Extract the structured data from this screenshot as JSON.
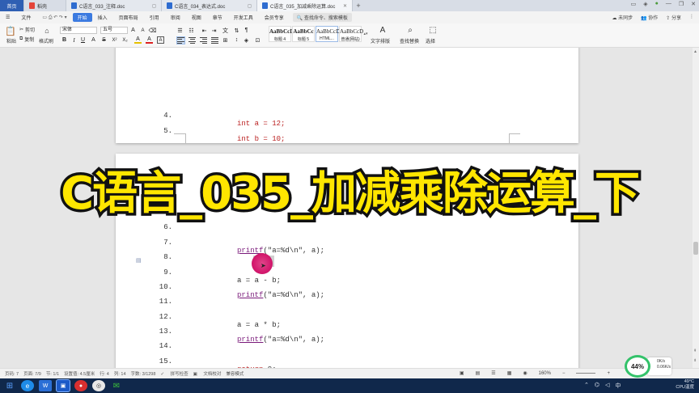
{
  "tabs": [
    {
      "label": "首页",
      "kind": "home"
    },
    {
      "label": "稻壳",
      "kind": "docer"
    },
    {
      "label": "C语言_033_注释.doc",
      "kind": "doc"
    },
    {
      "label": "C语言_034_表达式.doc",
      "kind": "doc"
    },
    {
      "label": "C语言_035_加减乘除运算.doc",
      "kind": "doc",
      "active": true
    }
  ],
  "menu": {
    "file": "文件",
    "items": [
      "开始",
      "插入",
      "页面布局",
      "引用",
      "审阅",
      "视图",
      "章节",
      "开发工具",
      "会员专享"
    ],
    "active": "开始",
    "search": "查找命令、搜索模板",
    "right": [
      "未同步",
      "协作",
      "分享"
    ]
  },
  "ribbon": {
    "paste": "粘贴",
    "cut": "剪切",
    "copy": "复制",
    "format_painter": "格式刷",
    "font_name": "宋体",
    "font_size": "五号",
    "styles": [
      {
        "preview": "AaBbCcDc",
        "name": "标题 4"
      },
      {
        "preview": "AaBbCc",
        "name": "标题 5"
      },
      {
        "preview": "AaBbCcDc",
        "name": "HTML..."
      },
      {
        "preview": "AaBbCcD",
        "name": "普通(网站)"
      }
    ],
    "text_tools": "文字排版",
    "find_replace": "查找替换",
    "select": "选择"
  },
  "page1_lines": [
    {
      "num": "4.",
      "code": "int a = 12;"
    },
    {
      "num": "5.",
      "code": "int b = 10;"
    }
  ],
  "page2_lines": [
    {
      "num": "6."
    },
    {
      "num": "7.",
      "fn": "printf",
      "rest": "(\"a=%d\\n\", a);"
    },
    {
      "num": "8."
    },
    {
      "num": "9.",
      "code": "a = a - b;"
    },
    {
      "num": "10.",
      "fn": "printf",
      "rest": "(\"a=%d\\n\", a);"
    },
    {
      "num": "11."
    },
    {
      "num": "12.",
      "code": "a = a * b;"
    },
    {
      "num": "13.",
      "fn": "printf",
      "rest": "(\"a=%d\\n\", a);"
    },
    {
      "num": "14."
    },
    {
      "num": "15.",
      "kw": "return",
      "rest": " 0;"
    }
  ],
  "banner": "C语言_035_加减乘除运算_下",
  "status": {
    "page": "页码: 7",
    "pages": "页面: 7/9",
    "section": "节: 1/1",
    "setting": "设置值: 4.5厘米",
    "row": "行: 4",
    "col": "列: 14",
    "words": "字数: 3/1298",
    "spell": "拼写检查",
    "proof": "文档校对",
    "compat": "兼容模式",
    "zoom": "160%"
  },
  "widget": {
    "percent": "44%",
    "up": "0K/s",
    "down": "0.06K/s"
  },
  "tray": {
    "temp": "49°C",
    "cpu": "CPU温度"
  }
}
